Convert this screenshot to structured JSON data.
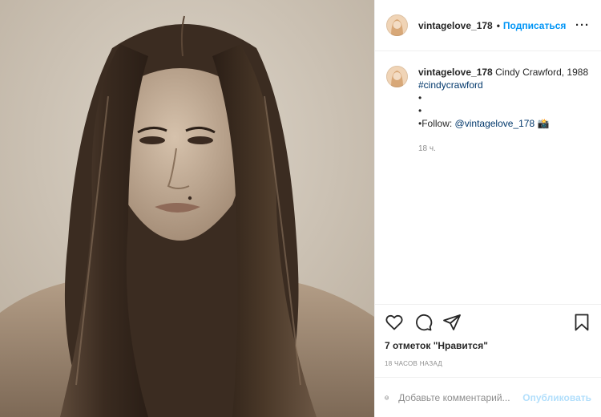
{
  "post": {
    "photo": {
      "subject": "photo-portrait"
    },
    "header": {
      "username": "vintagelove_178",
      "dot": "•",
      "follow_label": "Подписаться",
      "more_label": "···"
    },
    "caption": {
      "username": "vintagelove_178",
      "text": "Cindy Crawford, 1988",
      "hashtag": "#cindycrawford",
      "bullet1": "•",
      "bullet2": "•",
      "follow_prefix": "•Follow: ",
      "mention": "@vintagelove_178",
      "emoji": "📸",
      "time": "18 ч."
    },
    "actions": {
      "icons": [
        "heart-icon",
        "comment-icon",
        "share-icon",
        "bookmark-icon"
      ],
      "likes": "7 отметок \"Нравится\"",
      "posted": "18 часов назад"
    },
    "comment_box": {
      "placeholder": "Добавьте комментарий...",
      "publish_label": "Опубликовать"
    },
    "colors": {
      "link_blue": "#0095f6",
      "publish_disabled": "#b2dffc",
      "hashtag": "#00376b",
      "muted": "#8e8e8e"
    }
  }
}
